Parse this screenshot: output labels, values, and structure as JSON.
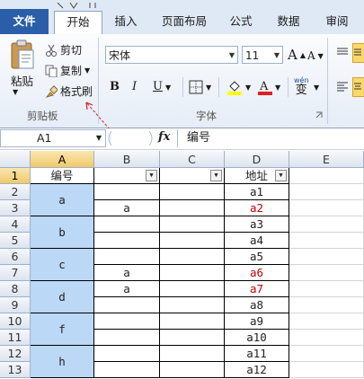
{
  "tabs": [
    "文件",
    "开始",
    "插入",
    "页面布局",
    "公式",
    "数据",
    "审阅"
  ],
  "ribbon": {
    "clipboard": {
      "paste": "粘贴",
      "cut": "剪切",
      "copy": "复制",
      "format_painter": "格式刷",
      "label": "剪贴板"
    },
    "font": {
      "name": "宋体",
      "size": "11",
      "label": "字体",
      "bold": "B",
      "italic": "I",
      "underline": "U",
      "grow": "A",
      "shrink": "A",
      "pinyin_top": "wén",
      "pinyin_char": "变"
    }
  },
  "formula_bar": {
    "name_box": "A1",
    "fx": "fx",
    "content": "编号"
  },
  "columns": [
    "A",
    "B",
    "C",
    "D",
    "E"
  ],
  "rows": [
    "1",
    "2",
    "3",
    "4",
    "5",
    "6",
    "7",
    "8",
    "9",
    "10",
    "11",
    "12",
    "13"
  ],
  "headers": {
    "A": "编号",
    "D": "地址"
  },
  "merged_a": [
    {
      "label": "a",
      "rows": "2-3"
    },
    {
      "label": "b",
      "rows": "4-5"
    },
    {
      "label": "c",
      "rows": "6-7"
    },
    {
      "label": "d",
      "rows": "8-9"
    },
    {
      "label": "f",
      "rows": "10-11"
    },
    {
      "label": "h",
      "rows": "12-13"
    }
  ],
  "col_b": {
    "3": "a",
    "7": "a",
    "8": "a"
  },
  "col_d": [
    "a1",
    "a2",
    "a3",
    "a4",
    "a5",
    "a6",
    "a7",
    "a8",
    "a9",
    "a10",
    "a11",
    "a12"
  ],
  "red_cells_d": [
    "a2",
    "a6",
    "a7"
  ],
  "colors": {
    "file_tab": "#2a5ea8",
    "selection": "#bbd9f7",
    "red_text": "#c00000",
    "arrow": "#d02020"
  }
}
